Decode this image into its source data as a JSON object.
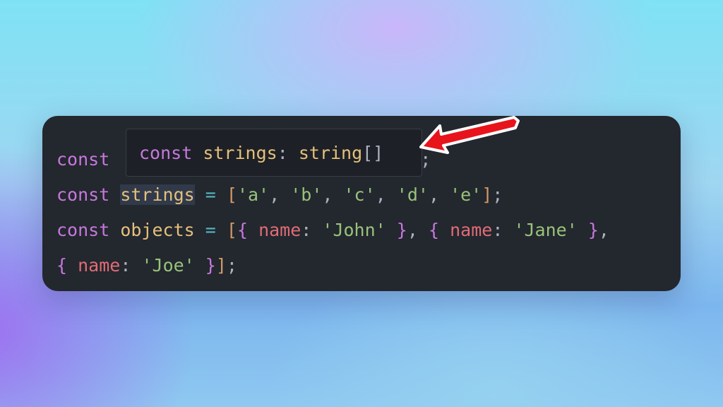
{
  "code": {
    "line1": {
      "keyword": "const",
      "semicolon": ";"
    },
    "line2": {
      "keyword": "const",
      "name": "strings",
      "assign": "=",
      "open": "[",
      "items": [
        "'a'",
        "'b'",
        "'c'",
        "'d'",
        "'e'"
      ],
      "sep": ",",
      "close": "]",
      "semicolon": ";"
    },
    "line3": {
      "keyword": "const",
      "name": "objects",
      "assign": "=",
      "open_array": "[",
      "open_brace": "{",
      "close_brace": "}",
      "prop": "name",
      "colon": ":",
      "value1": "'John'",
      "value2": "'Jane'",
      "sep": ","
    },
    "line4": {
      "open_brace": "{",
      "prop": "name",
      "colon": ":",
      "value": "'Joe'",
      "close_brace": "}",
      "close_array": "]",
      "semicolon": ";"
    }
  },
  "tooltip": {
    "keyword": "const",
    "name": "strings",
    "colon": ":",
    "type": "string",
    "brackets": "[]"
  },
  "colors": {
    "keyword": "#c678dd",
    "variable": "#e5c07b",
    "operator": "#56b6c2",
    "bracket": "#d19a66",
    "string": "#98c379",
    "property": "#e06c75",
    "arrow": "#e8141b"
  },
  "annotation": {
    "icon": "red-arrow-icon"
  }
}
